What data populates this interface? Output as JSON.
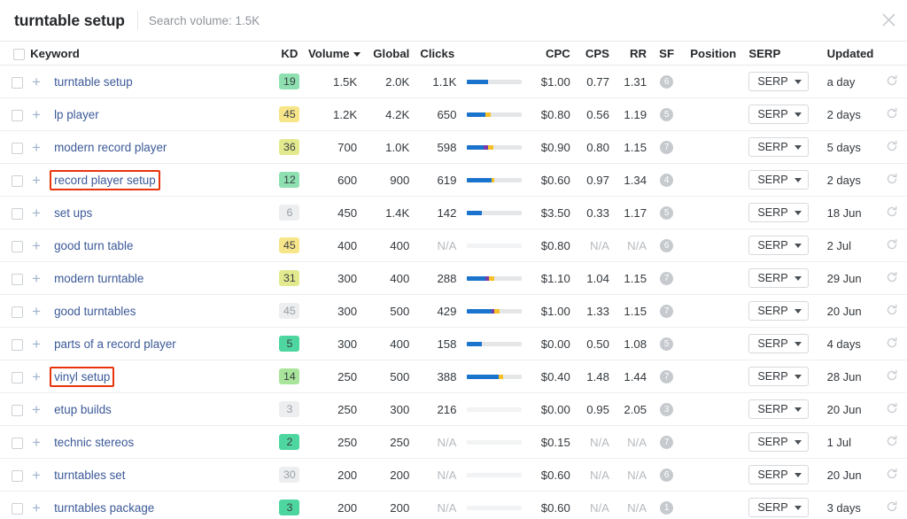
{
  "header": {
    "title": "turntable setup",
    "search_volume_label": "Search volume: 1.5K",
    "close_icon": "close-icon"
  },
  "table": {
    "columns": [
      {
        "key": "keyword",
        "label": "Keyword"
      },
      {
        "key": "kd",
        "label": "KD"
      },
      {
        "key": "volume",
        "label": "Volume"
      },
      {
        "key": "global",
        "label": "Global"
      },
      {
        "key": "clicks",
        "label": "Clicks"
      },
      {
        "key": "cpc",
        "label": "CPC"
      },
      {
        "key": "cps",
        "label": "CPS"
      },
      {
        "key": "rr",
        "label": "RR"
      },
      {
        "key": "sf",
        "label": "SF"
      },
      {
        "key": "position",
        "label": "Position"
      },
      {
        "key": "serp",
        "label": "SERP"
      },
      {
        "key": "updated",
        "label": "Updated"
      }
    ],
    "sorted_by": "Volume",
    "sort_direction": "desc",
    "serp_button_label": "SERP",
    "add_icon": "plus-icon",
    "refresh_icon": "refresh-icon",
    "highlight_color": "#e8340c",
    "rows": [
      {
        "keyword": "turntable setup",
        "highlighted": false,
        "kd": "19",
        "kd_color": "kd-green",
        "volume": "1.5K",
        "global": "2.0K",
        "clicks": "1.1K",
        "bar": [
          38,
          0,
          0
        ],
        "cpc": "$1.00",
        "cps": "0.77",
        "rr": "1.31",
        "sf": "6",
        "position": "",
        "serp": "SERP",
        "updated": "a day"
      },
      {
        "keyword": "lp player",
        "highlighted": false,
        "kd": "45",
        "kd_color": "kd-yellow",
        "volume": "1.2K",
        "global": "4.2K",
        "clicks": "650",
        "bar": [
          33,
          0,
          10
        ],
        "cpc": "$0.80",
        "cps": "0.56",
        "rr": "1.19",
        "sf": "5",
        "position": "",
        "serp": "SERP",
        "updated": "2 days"
      },
      {
        "keyword": "modern record player",
        "highlighted": false,
        "kd": "36",
        "kd_color": "kd-ygreen",
        "volume": "700",
        "global": "1.0K",
        "clicks": "598",
        "bar": [
          30,
          8,
          9
        ],
        "cpc": "$0.90",
        "cps": "0.80",
        "rr": "1.15",
        "sf": "7",
        "position": "",
        "serp": "SERP",
        "updated": "5 days"
      },
      {
        "keyword": "record player setup",
        "highlighted": true,
        "kd": "12",
        "kd_color": "kd-green",
        "volume": "600",
        "global": "900",
        "clicks": "619",
        "bar": [
          45,
          0,
          5
        ],
        "cpc": "$0.60",
        "cps": "0.97",
        "rr": "1.34",
        "sf": "4",
        "position": "",
        "serp": "SERP",
        "updated": "2 days"
      },
      {
        "keyword": "set ups",
        "highlighted": false,
        "kd": "6",
        "kd_color": "kd-gray",
        "volume": "450",
        "global": "1.4K",
        "clicks": "142",
        "bar": [
          26,
          0,
          0
        ],
        "cpc": "$3.50",
        "cps": "0.33",
        "rr": "1.17",
        "sf": "5",
        "position": "",
        "serp": "SERP",
        "updated": "18 Jun"
      },
      {
        "keyword": "good turn table",
        "highlighted": false,
        "kd": "45",
        "kd_color": "kd-yellow",
        "volume": "400",
        "global": "400",
        "clicks": "N/A",
        "bar": [
          0,
          0,
          0
        ],
        "cpc": "$0.80",
        "cps": "N/A",
        "rr": "N/A",
        "sf": "6",
        "position": "",
        "serp": "SERP",
        "updated": "2 Jul"
      },
      {
        "keyword": "modern turntable",
        "highlighted": false,
        "kd": "31",
        "kd_color": "kd-ygreen",
        "volume": "300",
        "global": "400",
        "clicks": "288",
        "bar": [
          33,
          6,
          11
        ],
        "cpc": "$1.10",
        "cps": "1.04",
        "rr": "1.15",
        "sf": "7",
        "position": "",
        "serp": "SERP",
        "updated": "29 Jun"
      },
      {
        "keyword": "good turntables",
        "highlighted": false,
        "kd": "45",
        "kd_color": "kd-gray",
        "volume": "300",
        "global": "500",
        "clicks": "429",
        "bar": [
          44,
          5,
          10
        ],
        "cpc": "$1.00",
        "cps": "1.33",
        "rr": "1.15",
        "sf": "7",
        "position": "",
        "serp": "SERP",
        "updated": "20 Jun"
      },
      {
        "keyword": "parts of a record player",
        "highlighted": false,
        "kd": "5",
        "kd_color": "kd-green2",
        "volume": "300",
        "global": "400",
        "clicks": "158",
        "bar": [
          27,
          0,
          0
        ],
        "cpc": "$0.00",
        "cps": "0.50",
        "rr": "1.08",
        "sf": "5",
        "position": "",
        "serp": "SERP",
        "updated": "4 days"
      },
      {
        "keyword": "vinyl setup",
        "highlighted": true,
        "kd": "14",
        "kd_color": "kd-lgreen",
        "volume": "250",
        "global": "500",
        "clicks": "388",
        "bar": [
          58,
          0,
          8
        ],
        "cpc": "$0.40",
        "cps": "1.48",
        "rr": "1.44",
        "sf": "7",
        "position": "",
        "serp": "SERP",
        "updated": "28 Jun"
      },
      {
        "keyword": "etup builds",
        "highlighted": false,
        "kd": "3",
        "kd_color": "kd-gray",
        "volume": "250",
        "global": "300",
        "clicks": "216",
        "bar": [
          0,
          0,
          0
        ],
        "cpc": "$0.00",
        "cps": "0.95",
        "rr": "2.05",
        "sf": "3",
        "position": "",
        "serp": "SERP",
        "updated": "20 Jun"
      },
      {
        "keyword": "technic stereos",
        "highlighted": false,
        "kd": "2",
        "kd_color": "kd-green2",
        "volume": "250",
        "global": "250",
        "clicks": "N/A",
        "bar": [
          0,
          0,
          0
        ],
        "cpc": "$0.15",
        "cps": "N/A",
        "rr": "N/A",
        "sf": "7",
        "position": "",
        "serp": "SERP",
        "updated": "1 Jul"
      },
      {
        "keyword": "turntables set",
        "highlighted": false,
        "kd": "30",
        "kd_color": "kd-gray",
        "volume": "200",
        "global": "200",
        "clicks": "N/A",
        "bar": [
          0,
          0,
          0
        ],
        "cpc": "$0.60",
        "cps": "N/A",
        "rr": "N/A",
        "sf": "6",
        "position": "",
        "serp": "SERP",
        "updated": "20 Jun"
      },
      {
        "keyword": "turntables package",
        "highlighted": false,
        "kd": "3",
        "kd_color": "kd-green2",
        "volume": "200",
        "global": "200",
        "clicks": "N/A",
        "bar": [
          0,
          0,
          0
        ],
        "cpc": "$0.60",
        "cps": "N/A",
        "rr": "N/A",
        "sf": "1",
        "position": "",
        "serp": "SERP",
        "updated": "3 days"
      }
    ]
  }
}
